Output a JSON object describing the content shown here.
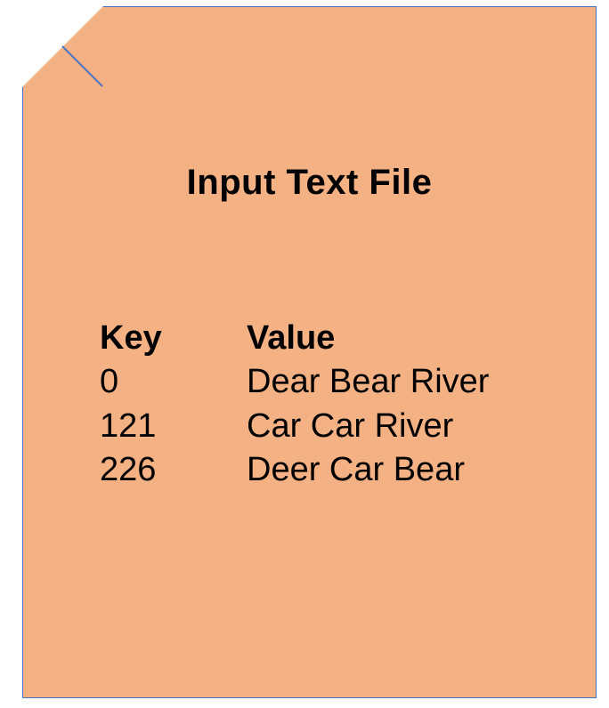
{
  "title": "Input Text File",
  "headers": {
    "key": "Key",
    "value": "Value"
  },
  "rows": [
    {
      "key": "0",
      "value": "Dear Bear River"
    },
    {
      "key": "121",
      "value": "Car Car River"
    },
    {
      "key": "226",
      "value": "Deer Car Bear"
    }
  ]
}
